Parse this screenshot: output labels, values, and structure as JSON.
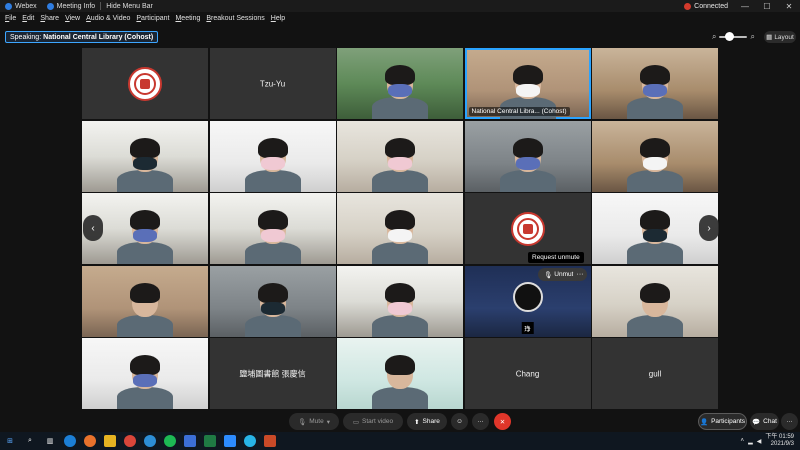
{
  "titlebar": {
    "app_name": "Webex",
    "meeting_info": "Meeting Info",
    "hide_menu_bar": "Hide Menu Bar",
    "status": "Connected",
    "minimize": "—",
    "maximize": "☐",
    "close": "✕"
  },
  "menubar": {
    "items": [
      {
        "key": "F",
        "rest": "ile"
      },
      {
        "key": "E",
        "rest": "dit"
      },
      {
        "key": "S",
        "rest": "hare"
      },
      {
        "key": "V",
        "rest": "iew"
      },
      {
        "key": "A",
        "rest": "udio & Video"
      },
      {
        "key": "P",
        "rest": "articipant"
      },
      {
        "key": "M",
        "rest": "eeting"
      },
      {
        "key": "B",
        "rest": "reakout Sessions"
      },
      {
        "key": "H",
        "rest": "elp"
      }
    ]
  },
  "speaking": {
    "label": "Speaking:",
    "name": "National Central Library (Cohost)"
  },
  "layout_button": "Layout",
  "tiles": [
    {
      "type": "logo"
    },
    {
      "type": "name",
      "name": "Tzu-Yu"
    },
    {
      "type": "video",
      "scene": "scene-green",
      "mask": "blue"
    },
    {
      "type": "video",
      "scene": "scene-shelf",
      "mask": "white",
      "caption": "National Central Libra... (Cohost)",
      "active": true
    },
    {
      "type": "video",
      "scene": "scene-warm",
      "mask": "blue"
    },
    {
      "type": "video",
      "scene": "scene-office",
      "mask": "dark"
    },
    {
      "type": "video",
      "scene": "scene-white",
      "mask": "pink"
    },
    {
      "type": "video",
      "scene": "scene-room",
      "mask": "pink"
    },
    {
      "type": "video",
      "scene": "scene-grey",
      "mask": "blue"
    },
    {
      "type": "video",
      "scene": "scene-warm",
      "mask": "white"
    },
    {
      "type": "video",
      "scene": "scene-office",
      "mask": "blue"
    },
    {
      "type": "video",
      "scene": "scene-office",
      "mask": "pink"
    },
    {
      "type": "video",
      "scene": "scene-room",
      "mask": "white"
    },
    {
      "type": "logo"
    },
    {
      "type": "video",
      "scene": "scene-white",
      "mask": "dark"
    },
    {
      "type": "video",
      "scene": "scene-shelf",
      "mask": "none"
    },
    {
      "type": "video",
      "scene": "scene-grey",
      "mask": "dark"
    },
    {
      "type": "video",
      "scene": "scene-office",
      "mask": "pink"
    },
    {
      "type": "obs",
      "name": "琤"
    },
    {
      "type": "video",
      "scene": "scene-room",
      "mask": "none"
    },
    {
      "type": "video",
      "scene": "scene-white",
      "mask": "blue"
    },
    {
      "type": "name",
      "name": "鹽埔圖書館 張慶信"
    },
    {
      "type": "video",
      "scene": "scene-poster",
      "mask": "none"
    },
    {
      "type": "name",
      "name": "Chang"
    },
    {
      "type": "name",
      "name": "gull"
    }
  ],
  "hover": {
    "tooltip": "Request unmute",
    "unmute": "Unmute",
    "more": "···"
  },
  "controls": {
    "mute": "Mute",
    "start_video": "Start video",
    "share": "Share",
    "participants": "Participants",
    "chat": "Chat"
  },
  "clock": {
    "time": "下午 01:59",
    "date": "2021/9/3"
  },
  "colors": {
    "accent": "#2aa3ff",
    "end_call": "#e0362a",
    "connected_dot": "#d33a2c"
  }
}
